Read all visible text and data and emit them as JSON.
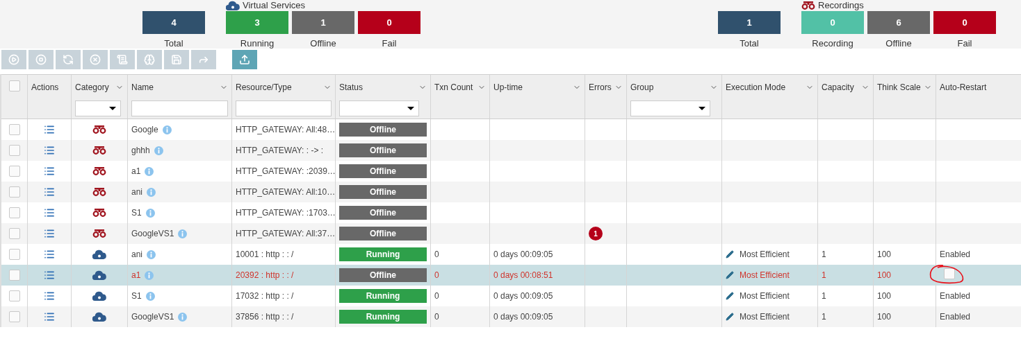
{
  "summary": [
    {
      "kind": "services",
      "title": "Virtual Services",
      "tiles": [
        {
          "value": "4",
          "label": "Total",
          "color": "#30516d"
        },
        {
          "value": "3",
          "label": "Running",
          "color": "#2ea04a"
        },
        {
          "value": "1",
          "label": "Offline",
          "color": "#686868"
        },
        {
          "value": "0",
          "label": "Fail",
          "color": "#b5001a"
        }
      ]
    },
    {
      "kind": "recordings",
      "title": "Recordings",
      "tiles": [
        {
          "value": "1",
          "label": "Total",
          "color": "#30516d"
        },
        {
          "value": "0",
          "label": "Recording",
          "color": "#52c1a6"
        },
        {
          "value": "6",
          "label": "Offline",
          "color": "#686868"
        },
        {
          "value": "0",
          "label": "Fail",
          "color": "#b5001a"
        }
      ]
    }
  ],
  "toolbar": [
    {
      "disabled": true
    },
    {
      "disabled": true
    },
    {
      "disabled": true
    },
    {
      "disabled": true
    },
    {
      "disabled": true
    },
    {
      "disabled": true
    },
    {
      "disabled": true
    },
    {
      "disabled": true
    },
    {
      "disabled": false
    }
  ],
  "table": {
    "select_all": {
      "checked": false
    },
    "columns": [
      {
        "label": "Actions",
        "menu": false
      },
      {
        "label": "Category",
        "menu": true,
        "kind": "select"
      },
      {
        "label": "Name",
        "menu": true,
        "kind": "text"
      },
      {
        "label": "Resource/Type",
        "menu": true,
        "kind": "text"
      },
      {
        "label": "Status",
        "menu": true,
        "kind": "select"
      },
      {
        "label": "Txn Count",
        "menu": true
      },
      {
        "label": "Up-time",
        "menu": true
      },
      {
        "label": "Errors",
        "menu": true
      },
      {
        "label": "Group",
        "menu": true,
        "kind": "select"
      },
      {
        "label": "Execution Mode",
        "menu": true
      },
      {
        "label": "Capacity",
        "menu": true
      },
      {
        "label": "Think Scale",
        "menu": true
      },
      {
        "label": "Auto-Restart",
        "menu": false
      }
    ],
    "rows": [
      {
        "checked": false,
        "selected": false,
        "kind": "recording",
        "name": "Google",
        "resource": "HTTP_GATEWAY: All:48…",
        "status": {
          "label": "Offline",
          "kind": "offline"
        }
      },
      {
        "checked": false,
        "selected": false,
        "kind": "recording",
        "name": "ghhh",
        "resource": "HTTP_GATEWAY: : -> :",
        "status": {
          "label": "Offline",
          "kind": "offline"
        }
      },
      {
        "checked": false,
        "selected": false,
        "kind": "recording",
        "name": "a1",
        "resource": "HTTP_GATEWAY: :2039…",
        "status": {
          "label": "Offline",
          "kind": "offline"
        }
      },
      {
        "checked": false,
        "selected": false,
        "kind": "recording",
        "name": "ani",
        "resource": "HTTP_GATEWAY: All:10…",
        "status": {
          "label": "Offline",
          "kind": "offline"
        }
      },
      {
        "checked": false,
        "selected": false,
        "kind": "recording",
        "name": "S1",
        "resource": "HTTP_GATEWAY: :1703…",
        "status": {
          "label": "Offline",
          "kind": "offline"
        }
      },
      {
        "checked": false,
        "selected": false,
        "kind": "recording",
        "name": "GoogleVS1",
        "resource": "HTTP_GATEWAY: All:37…",
        "status": {
          "label": "Offline",
          "kind": "offline"
        },
        "errors": "1"
      },
      {
        "checked": false,
        "selected": false,
        "kind": "service",
        "name": "ani",
        "resource": "10001 : http : : /",
        "status": {
          "label": "Running",
          "kind": "running"
        },
        "txn": "0",
        "uptime": "0 days 00:09:05",
        "mode": "Most Efficient",
        "capacity": "1",
        "think": "100",
        "auto_restart": {
          "kind": "text",
          "text": "Enabled"
        }
      },
      {
        "checked": false,
        "selected": true,
        "annotated": true,
        "kind": "service",
        "name": "a1",
        "resource": "20392 : http : : /",
        "status": {
          "label": "Offline",
          "kind": "offline"
        },
        "txn": "0",
        "uptime": "0 days 00:08:51",
        "mode": "Most Efficient",
        "capacity": "1",
        "think": "100",
        "auto_restart": {
          "kind": "checkbox",
          "checked": false
        }
      },
      {
        "checked": false,
        "selected": false,
        "kind": "service",
        "name": "S1",
        "resource": "17032 : http : : /",
        "status": {
          "label": "Running",
          "kind": "running"
        },
        "txn": "0",
        "uptime": "0 days 00:09:05",
        "mode": "Most Efficient",
        "capacity": "1",
        "think": "100",
        "auto_restart": {
          "kind": "text",
          "text": "Enabled"
        }
      },
      {
        "checked": false,
        "selected": false,
        "kind": "service",
        "name": "GoogleVS1",
        "resource": "37856 : http : : /",
        "status": {
          "label": "Running",
          "kind": "running"
        },
        "txn": "0",
        "uptime": "0 days 00:09:05",
        "mode": "Most Efficient",
        "capacity": "1",
        "think": "100",
        "auto_restart": {
          "kind": "text",
          "text": "Enabled"
        }
      }
    ]
  }
}
